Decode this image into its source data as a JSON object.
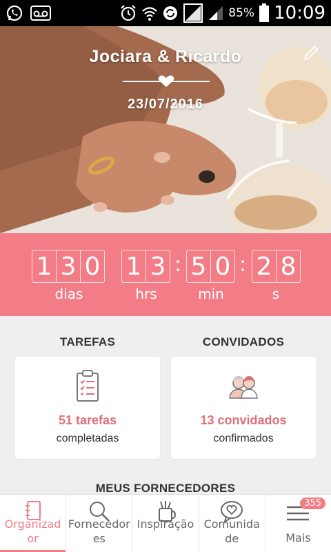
{
  "status_bar": {
    "battery_percent": "85%",
    "time": "10:09",
    "icons": [
      "whatsapp-icon",
      "voicemail-icon",
      "alarm-icon",
      "wifi-icon",
      "sync-icon",
      "no-sim-icon",
      "signal-icon",
      "battery-icon"
    ]
  },
  "hero": {
    "couple_names": "Jociara & Ricardo",
    "wedding_date": "23/07/2016",
    "divider_icon": "heart-icon",
    "edit_icon": "pencil-icon"
  },
  "countdown": {
    "days_digits": [
      "1",
      "3",
      "0"
    ],
    "hours_digits": [
      "1",
      "3"
    ],
    "minutes_digits": [
      "5",
      "0"
    ],
    "seconds_digits": [
      "2",
      "8"
    ],
    "separator": ":",
    "labels": {
      "days": "dias",
      "hours": "hrs",
      "minutes": "min",
      "seconds": "s"
    }
  },
  "tasks": {
    "title": "TAREFAS",
    "icon": "checklist-icon",
    "count_text": "51 tarefas",
    "sub_text": "completadas"
  },
  "guests": {
    "title": "CONVIDADOS",
    "icon": "guests-icon",
    "count_text": "13 convidados",
    "sub_text": "confirmados"
  },
  "suppliers": {
    "title": "MEUS FORNECEDORES"
  },
  "bottom_nav": {
    "items": [
      {
        "label_line1": "Organizad",
        "label_line2": "or",
        "icon": "notebook-icon",
        "active": true
      },
      {
        "label_line1": "Fornecedor",
        "label_line2": "es",
        "icon": "search-icon",
        "active": false
      },
      {
        "label_line1": "Inspiração",
        "label_line2": "",
        "icon": "inspiration-icon",
        "active": false
      },
      {
        "label_line1": "Comunida",
        "label_line2": "de",
        "icon": "community-heart-icon",
        "active": false
      },
      {
        "label_line1": "Mais",
        "label_line2": "",
        "icon": "menu-icon",
        "active": false,
        "badge": "355"
      }
    ]
  },
  "colors": {
    "accent": "#f37d87",
    "accent_text": "#e07077",
    "background": "#efefef"
  }
}
